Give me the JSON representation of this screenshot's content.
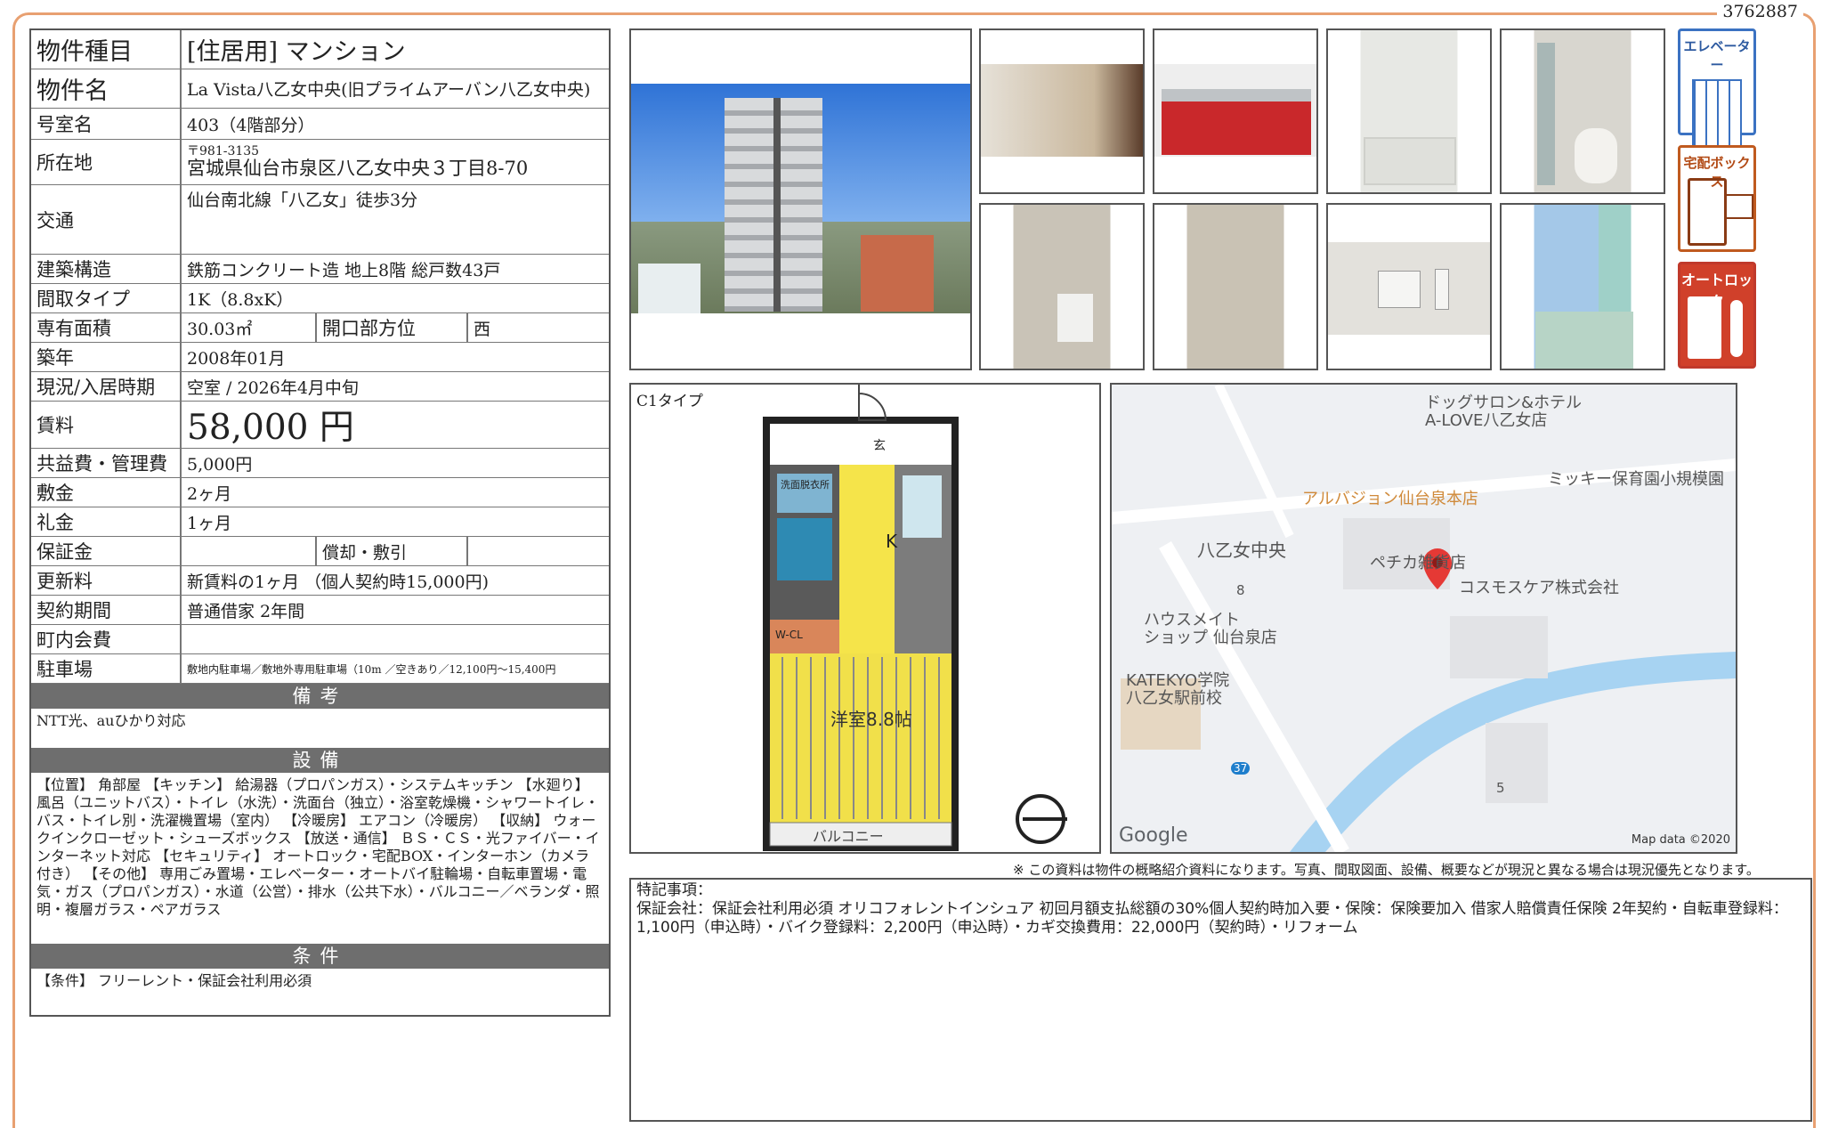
{
  "doc_id": "3762887",
  "property": {
    "type_label": "物件種目",
    "type_value": "[住居用] マンション",
    "name_label": "物件名",
    "name_value": "La Vista八乙女中央(旧プライムアーバン八乙女中央)",
    "room_label": "号室名",
    "room_value": "403（4階部分）",
    "address_label": "所在地",
    "zip": "〒981-3135",
    "address": "宮城県仙台市泉区八乙女中央３丁目8-70",
    "access_label": "交通",
    "access_value": "仙台南北線「八乙女」徒歩3分",
    "structure_label": "建築構造",
    "structure_value": "鉄筋コンクリート造 地上8階 総戸数43戸",
    "layout_label": "間取タイプ",
    "layout_value": "1K（8.8xK）",
    "area_label": "専有面積",
    "area_value": "30.03㎡",
    "direction_label": "開口部方位",
    "direction_value": "西",
    "built_label": "築年",
    "built_value": "2008年01月",
    "status_label": "現況/入居時期",
    "status_value": "空室 / 2026年4月中旬",
    "rent_label": "賃料",
    "rent_value": "58,000 円",
    "fee_label": "共益費・管理費",
    "fee_value": "5,000円",
    "deposit_label": "敷金",
    "deposit_value": "2ヶ月",
    "key_money_label": "礼金",
    "key_money_value": "1ヶ月",
    "guarantee_label": "保証金",
    "guarantee_value": "",
    "amort_label": "償却・敷引",
    "amort_value": "",
    "renewal_label": "更新料",
    "renewal_value": "新賃料の1ヶ月 （個人契約時15,000円)",
    "contract_label": "契約期間",
    "contract_value": "普通借家 2年間",
    "assoc_label": "町内会費",
    "assoc_value": "",
    "parking_label": "駐車場",
    "parking_value": "敷地内駐車場／敷地外専用駐車場（10m ／空きあり／12,100円～15,400円"
  },
  "sections": {
    "notes_title": "備考",
    "notes_text": "NTT光、auひかり対応",
    "equipment_title": "設備",
    "equipment_text": "【位置】 角部屋 【キッチン】 給湯器（プロパンガス）・システムキッチン 【水廻り】 風呂（ユニットバス）・トイレ（水洗）・洗面台（独立）・浴室乾燥機・シャワートイレ・バス・トイレ別・洗濯機置場（室内） 【冷暖房】 エアコン（冷暖房） 【収納】 ウォークインクローゼット・シューズボックス 【放送・通信】 ＢＳ・ＣＳ・光ファイバー・インターネット対応 【セキュリティ】 オートロック・宅配BOX・インターホン（カメラ付き） 【その他】 専用ごみ置場・エレベーター・オートバイ駐輪場・自転車置場・電気・ガス（プロパンガス）・水道（公営）・排水（公共下水）・バルコニー／ベランダ・照明・複層ガラス・ペアガラス",
    "conditions_title": "条件",
    "conditions_text": "【条件】 フリーレント・保証会社利用必須"
  },
  "badges": {
    "elevator": "エレベーター",
    "delivery": "宅配ボックス",
    "autolock": "オートロック"
  },
  "floorplan": {
    "type_label": "C1タイプ",
    "kitchen": "K",
    "wcl": "W-CL",
    "room": "洋室8.8帖",
    "balcony": "バルコニー",
    "wash": "洗面脱衣所",
    "closet": "玄"
  },
  "map": {
    "labels": [
      "ドッグサロン&ホテル",
      "A-LOVE八乙女店",
      "ミッキー保育園小規模園",
      "アルバジョン仙台泉本店",
      "八乙女中央",
      "ペチカ雑貨店",
      "コスモスケア株式会社",
      "ハウスメイト",
      "ショップ 仙台泉店",
      "KATEKYO学院",
      "八乙女駅前校",
      "8",
      "5",
      "37"
    ],
    "google": "Google",
    "credit": "Map data ©2020"
  },
  "notice": "※ この資料は物件の概略紹介資料になります。写真、間取図面、設備、概要などが現況と異なる場合は現況優先となります。",
  "remarks": {
    "title": "特記事項：",
    "text": "保証会社：保証会社利用必須 オリコフォレントインシュア 初回月額支払総額の30%個人契約時加入要・保険：保険要加入 借家人賠償責任保険 2年契約・自転車登録料：1,100円（申込時）・バイク登録料：2,200円（申込時）・カギ交換費用：22,000円（契約時）・リフォーム"
  }
}
